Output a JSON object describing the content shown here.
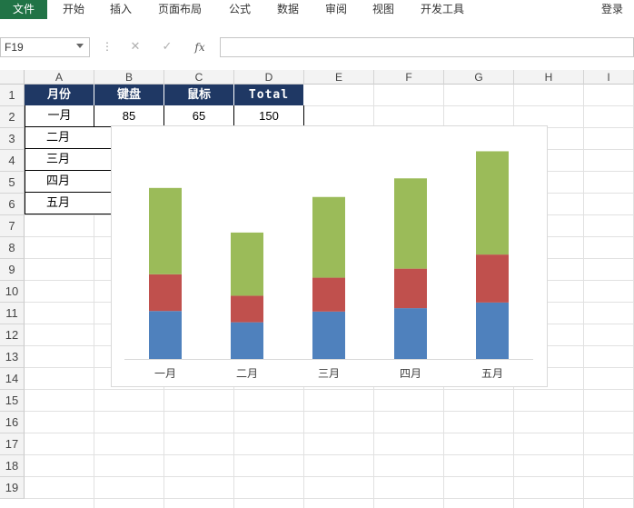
{
  "ribbon": {
    "file": "文件",
    "tabs": [
      "开始",
      "插入",
      "页面布局",
      "公式",
      "数据",
      "审阅",
      "视图",
      "开发工具"
    ],
    "login": "登录"
  },
  "formula_bar": {
    "name_box": "F19",
    "cancel_icon": "cancel-icon",
    "enter_icon": "check-icon",
    "fx_label": "fx",
    "formula": ""
  },
  "columns": [
    "A",
    "B",
    "C",
    "D",
    "E",
    "F",
    "G",
    "H",
    "I"
  ],
  "rows": [
    "1",
    "2",
    "3",
    "4",
    "5",
    "6",
    "7",
    "8",
    "9",
    "10",
    "11",
    "12",
    "13",
    "14",
    "15",
    "16",
    "17",
    "18",
    "19"
  ],
  "table": {
    "headers": [
      "月份",
      "键盘",
      "鼠标",
      "Total"
    ],
    "months": [
      "一月",
      "二月",
      "三月",
      "四月",
      "五月"
    ],
    "row2": [
      "85",
      "65",
      "150"
    ]
  },
  "chart_data": {
    "type": "bar",
    "stacked": true,
    "categories": [
      "一月",
      "二月",
      "三月",
      "四月",
      "五月"
    ],
    "series": [
      {
        "color": "#4f81bd",
        "values": [
          85,
          65,
          84,
          90,
          100
        ]
      },
      {
        "color": "#c0504d",
        "values": [
          65,
          47,
          60,
          70,
          85
        ]
      },
      {
        "color": "#9bbb59",
        "values": [
          153,
          112,
          143,
          160,
          183
        ]
      }
    ],
    "ylim": [
      0,
      380
    ],
    "grid": false,
    "legend": "none"
  }
}
